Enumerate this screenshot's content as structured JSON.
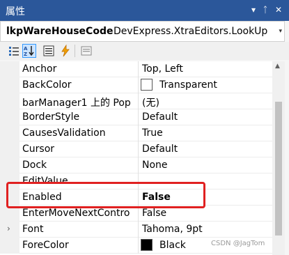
{
  "panel": {
    "title": "属性",
    "dropdown_glyph": "▾",
    "pin_glyph": "ᛏ",
    "close_glyph": "✕"
  },
  "object_selector": {
    "name": "lkpWareHouseCode",
    "type": "DevExpress.XtraEditors.LookUp",
    "arrow": "▾"
  },
  "toolbar": {
    "buttons": [
      "categorized-icon",
      "alphabetical-icon",
      "properties-icon",
      "events-icon",
      "property-pages-icon"
    ],
    "alphabetical_text": "A↓Z",
    "events_glyph": "⚡"
  },
  "properties": [
    {
      "name": "Anchor",
      "value": "Top, Left"
    },
    {
      "name": "BackColor",
      "value": "Transparent",
      "swatch": "#ffffff"
    },
    {
      "name": "barManager1 上的 Pop",
      "value": "(无)"
    },
    {
      "name": "BorderStyle",
      "value": "Default"
    },
    {
      "name": "CausesValidation",
      "value": "True"
    },
    {
      "name": "Cursor",
      "value": "Default"
    },
    {
      "name": "Dock",
      "value": "None"
    },
    {
      "name": "EditValue",
      "value": ""
    },
    {
      "name": "Enabled",
      "value": "False",
      "bold": true
    },
    {
      "name": "EnterMoveNextContro",
      "value": "False"
    },
    {
      "name": "Font",
      "value": "Tahoma, 9pt",
      "expandable": true
    },
    {
      "name": "ForeColor",
      "value": "Black",
      "swatch": "#000000"
    }
  ],
  "expander_glyph": "›",
  "scroll_up_glyph": "▲",
  "highlight_color": "#e02020",
  "title_color": "#2b579a",
  "watermark": "CSDN @JagTom"
}
